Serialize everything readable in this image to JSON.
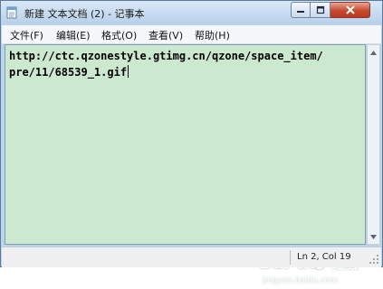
{
  "window": {
    "title": "新建 文本文档 (2) - 记事本",
    "app_icon": "notepad-icon"
  },
  "controls": {
    "minimize_icon": "minimize-icon",
    "maximize_icon": "maximize-icon",
    "close_icon": "close-icon"
  },
  "menu": {
    "items": [
      {
        "label": "文件(F)"
      },
      {
        "label": "编辑(E)"
      },
      {
        "label": "格式(O)"
      },
      {
        "label": "查看(V)"
      },
      {
        "label": "帮助(H)"
      }
    ]
  },
  "editor": {
    "lines": [
      "http://ctc.qzonestyle.gtimg.cn/qzone/space_item/",
      "pre/11/68539_1.gif"
    ],
    "background": "#cce8cf"
  },
  "status": {
    "position": "Ln 2, Col 19"
  },
  "watermark": {
    "brand": "Bai du",
    "product": "经验",
    "url": "jingyan.baidu.com"
  }
}
